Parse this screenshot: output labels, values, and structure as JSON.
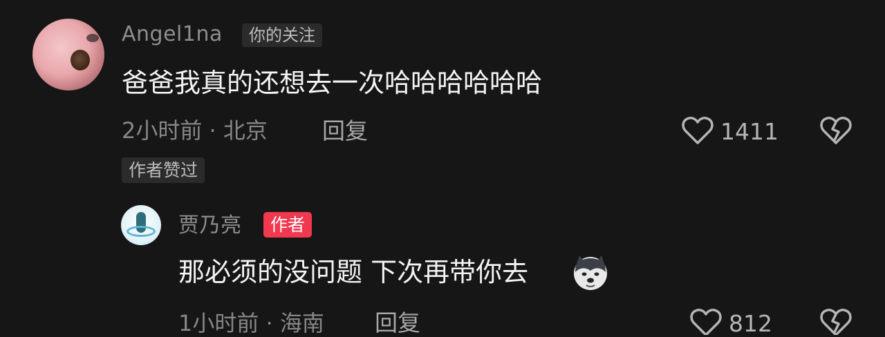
{
  "comments": [
    {
      "username": "Angel1na",
      "follow_tag": "你的关注",
      "text": "爸爸我真的还想去一次哈哈哈哈哈哈",
      "meta": "2小时前 · 北京",
      "reply_label": "回复",
      "likes": "1411",
      "author_liked_tag": "作者赞过"
    }
  ],
  "reply": {
    "username": "贾乃亮",
    "author_tag": "作者",
    "text": "那必须的没问题 下次再带你去",
    "emoji": "husky-emoji",
    "meta": "1小时前 · 海南",
    "reply_label": "回复",
    "likes": "812"
  },
  "colors": {
    "background": "#161616",
    "author_tag": "#f0384f"
  }
}
